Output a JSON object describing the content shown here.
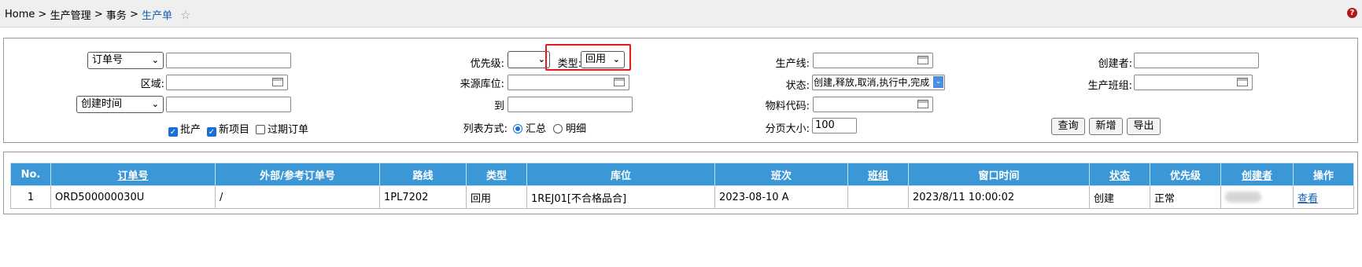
{
  "breadcrumb": {
    "home": "Home",
    "sep": ">",
    "level1": "生产管理",
    "level2": "事务",
    "current": "生产单"
  },
  "filters": {
    "order_field_select": "订单号",
    "order_input": "",
    "region_label": "区域:",
    "region_input": "",
    "date_field_select": "创建时间",
    "date_input": "",
    "batch_label": "批产",
    "new_item_label": "新项目",
    "expired_label": "过期订单",
    "batch_checked": true,
    "new_item_checked": true,
    "expired_checked": false,
    "priority_label": "优先级:",
    "priority_value": "",
    "type_label": "类型:",
    "type_value": "回用",
    "source_loc_label": "来源库位:",
    "source_loc_input": "",
    "to_label": "到",
    "to_input": "",
    "list_mode_label": "列表方式:",
    "summary_label": "汇总",
    "detail_label": "明细",
    "list_mode_selected": "汇总",
    "line_label": "生产线:",
    "line_input": "",
    "status_label": "状态:",
    "status_value": "创建,释放,取消,执行中,完成",
    "material_label": "物料代码:",
    "material_input": "",
    "page_size_label": "分页大小:",
    "page_size_value": "100",
    "creator_label": "创建者:",
    "creator_input": "",
    "team_label": "生产班组:",
    "team_input": "",
    "query_button": "查询",
    "add_button": "新增",
    "export_button": "导出"
  },
  "table": {
    "headers": [
      "No.",
      "订单号",
      "外部/参考订单号",
      "路线",
      "类型",
      "库位",
      "班次",
      "班组",
      "窗口时间",
      "状态",
      "优先级",
      "创建者",
      "操作"
    ],
    "rows": [
      {
        "no": "1",
        "order_no": "ORD500000030U",
        "ext_ref": "/",
        "route": "1PL7202",
        "type": "回用",
        "location": "1REJ01[不合格品合]",
        "shift": "2023-08-10 A",
        "team": "",
        "window_time": "2023/8/11 10:00:02",
        "status": "创建",
        "priority": "正常",
        "creator": "",
        "action": "查看"
      }
    ]
  },
  "colors": {
    "header_bg": "#3b97d6",
    "link": "#1a5fb4",
    "highlight": "#e01b1b",
    "topbar_bg": "#efefef"
  }
}
